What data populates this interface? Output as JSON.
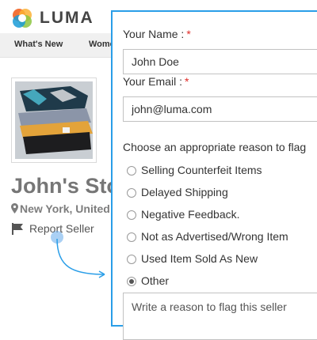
{
  "header": {
    "logo_text": "LUMA"
  },
  "nav": {
    "items": [
      "What's New",
      "Wome"
    ]
  },
  "store": {
    "name": "John's Sto",
    "location": "New York, United",
    "report_label": "Report Seller"
  },
  "modal": {
    "name_label": "Your Name :",
    "email_label": "Your Email :",
    "required_mark": "*",
    "name_value": "John Doe",
    "email_value": "john@luma.com",
    "reason_title": "Choose an appropriate reason to flag",
    "reasons": [
      {
        "label": "Selling Counterfeit Items",
        "checked": false
      },
      {
        "label": "Delayed Shipping",
        "checked": false
      },
      {
        "label": "Negative Feedback.",
        "checked": false
      },
      {
        "label": "Not as Advertised/Wrong Item",
        "checked": false
      },
      {
        "label": "Used Item Sold As New",
        "checked": false
      },
      {
        "label": "Other",
        "checked": true
      }
    ],
    "textarea_placeholder": "Write a reason to flag this seller"
  },
  "colors": {
    "accent": "#2a9ee8",
    "required": "#e02b27",
    "nav_bg": "#f0f0f0",
    "store_name": "#767676"
  },
  "icons": [
    "luma-logo-icon",
    "map-pin-icon",
    "flag-icon",
    "radio-icon"
  ]
}
